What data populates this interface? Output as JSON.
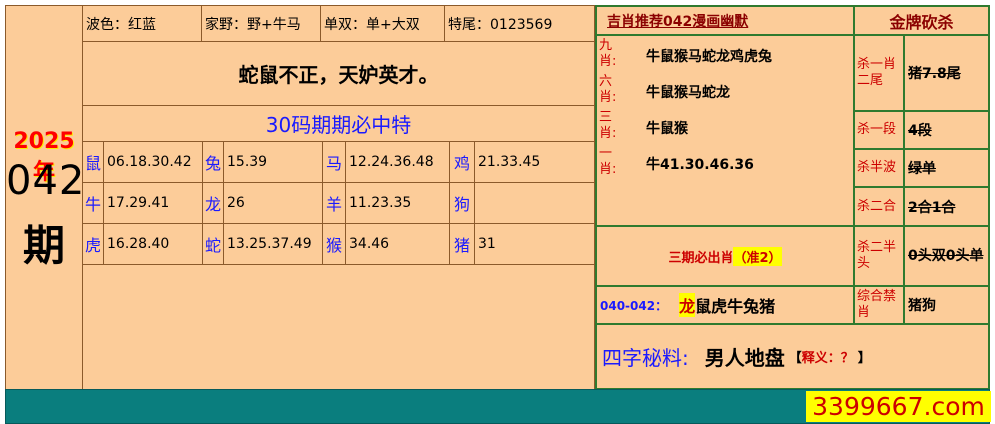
{
  "left_panel": {
    "year": "2025年",
    "num": "042",
    "period": "期"
  },
  "header": {
    "wave": "波色：红蓝",
    "domestic": "家野：野+牛马",
    "odd_even": "单双：单+大双",
    "tail": "特尾：0123569"
  },
  "poem": "蛇鼠不正，天妒英才。",
  "banner": "30码期期必中特",
  "zodiac_numbers": [
    [
      {
        "z": "鼠",
        "n": "06.18.30.42"
      },
      {
        "z": "兔",
        "n": "15.39"
      },
      {
        "z": "马",
        "n": "12.24.36.48"
      },
      {
        "z": "鸡",
        "n": "21.33.45"
      }
    ],
    [
      {
        "z": "牛",
        "n": "17.29.41"
      },
      {
        "z": "龙",
        "n": "26"
      },
      {
        "z": "羊",
        "n": "11.23.35"
      },
      {
        "z": "狗",
        "n": ""
      }
    ],
    [
      {
        "z": "虎",
        "n": "16.28.40"
      },
      {
        "z": "蛇",
        "n": "13.25.37.49"
      },
      {
        "z": "猴",
        "n": "34.46"
      },
      {
        "z": "猪",
        "n": "31"
      }
    ]
  ],
  "recommend": {
    "title": "吉肖推荐042漫画幽默",
    "rows": [
      {
        "label": "九肖:",
        "value": "牛鼠猴马蛇龙鸡虎兔"
      },
      {
        "label": "六肖:",
        "value": "牛鼠猴马蛇龙"
      },
      {
        "label": "三肖:",
        "value": "牛鼠猴"
      },
      {
        "label": "一肖:",
        "value": "牛41.30.46.36"
      }
    ]
  },
  "golden_kill": {
    "title": "金牌砍杀",
    "rows": [
      {
        "label": "杀一肖二尾",
        "value": "猪7.8尾"
      },
      {
        "label": "杀一段",
        "value": "4段"
      },
      {
        "label": "杀半波",
        "value": "绿单"
      },
      {
        "label": "杀二合",
        "value": "2合1合"
      },
      {
        "label": "杀二半头",
        "value": "0头双0头单"
      },
      {
        "label": "综合禁肖",
        "value": "猪狗"
      }
    ]
  },
  "three_period": {
    "text": "三期必出肖",
    "tag": "（准2）"
  },
  "history": {
    "label": "040-042：",
    "hit": "龙",
    "rest": "鼠虎牛兔猪"
  },
  "four_char": {
    "label": "四字秘料:",
    "value": "男人地盘",
    "note_open": "【",
    "note_label": "释义：",
    "note_value": "？",
    "note_close": "】"
  },
  "site": "3399667.com",
  "colors": {
    "bg": "#fccc99",
    "teal": "#0a7e7e",
    "green_border": "#2f7a2f",
    "blue": "#1a1aff",
    "red": "#cc0000",
    "site_bg": "#ffff00"
  }
}
